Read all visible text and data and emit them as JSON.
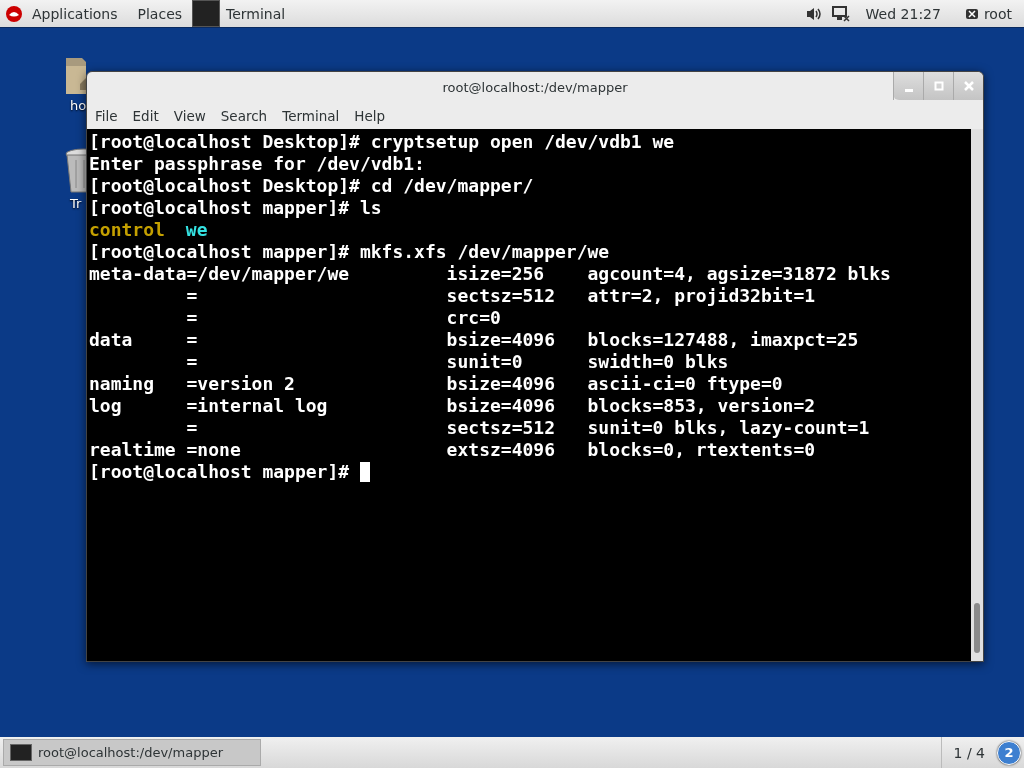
{
  "top_bar": {
    "menus": [
      "Applications",
      "Places"
    ],
    "active_app": "Terminal",
    "clock": "Wed 21:27",
    "user": "root"
  },
  "desktop_icons": [
    {
      "kind": "home",
      "label": "ho"
    },
    {
      "kind": "trash",
      "label": "Tr"
    }
  ],
  "window": {
    "title": "root@localhost:/dev/mapper",
    "menu": [
      "File",
      "Edit",
      "View",
      "Search",
      "Terminal",
      "Help"
    ],
    "terminal_lines": [
      [
        {
          "text": "[root@localhost Desktop]# cryptsetup open /dev/vdb1 we",
          "color": "#ffffff"
        }
      ],
      [
        {
          "text": "Enter passphrase for /dev/vdb1:",
          "color": "#ffffff"
        }
      ],
      [
        {
          "text": "[root@localhost Desktop]# cd /dev/mapper/",
          "color": "#ffffff"
        }
      ],
      [
        {
          "text": "[root@localhost mapper]# ls",
          "color": "#ffffff"
        }
      ],
      [
        {
          "text": "control",
          "color": "#c4a000"
        },
        {
          "text": "we",
          "color": "#34e2e2"
        }
      ],
      [
        {
          "text": "[root@localhost mapper]# mkfs.xfs /dev/mapper/we",
          "color": "#ffffff"
        }
      ],
      [
        {
          "text": "meta-data=/dev/mapper/we         isize=256    agcount=4, agsize=31872 blks",
          "color": "#ffffff"
        }
      ],
      [
        {
          "text": "         =                       sectsz=512   attr=2, projid32bit=1",
          "color": "#ffffff"
        }
      ],
      [
        {
          "text": "         =                       crc=0",
          "color": "#ffffff"
        }
      ],
      [
        {
          "text": "data     =                       bsize=4096   blocks=127488, imaxpct=25",
          "color": "#ffffff"
        }
      ],
      [
        {
          "text": "         =                       sunit=0      swidth=0 blks",
          "color": "#ffffff"
        }
      ],
      [
        {
          "text": "naming   =version 2              bsize=4096   ascii-ci=0 ftype=0",
          "color": "#ffffff"
        }
      ],
      [
        {
          "text": "log      =internal log           bsize=4096   blocks=853, version=2",
          "color": "#ffffff"
        }
      ],
      [
        {
          "text": "         =                       sectsz=512   sunit=0 blks, lazy-count=1",
          "color": "#ffffff"
        }
      ],
      [
        {
          "text": "realtime =none                   extsz=4096   blocks=0, rtextents=0",
          "color": "#ffffff"
        }
      ],
      [
        {
          "text": "[root@localhost mapper]#",
          "color": "#ffffff"
        }
      ]
    ]
  },
  "taskbar": {
    "task": "root@localhost:/dev/mapper",
    "workspace": "1 / 4",
    "badge": "2"
  }
}
